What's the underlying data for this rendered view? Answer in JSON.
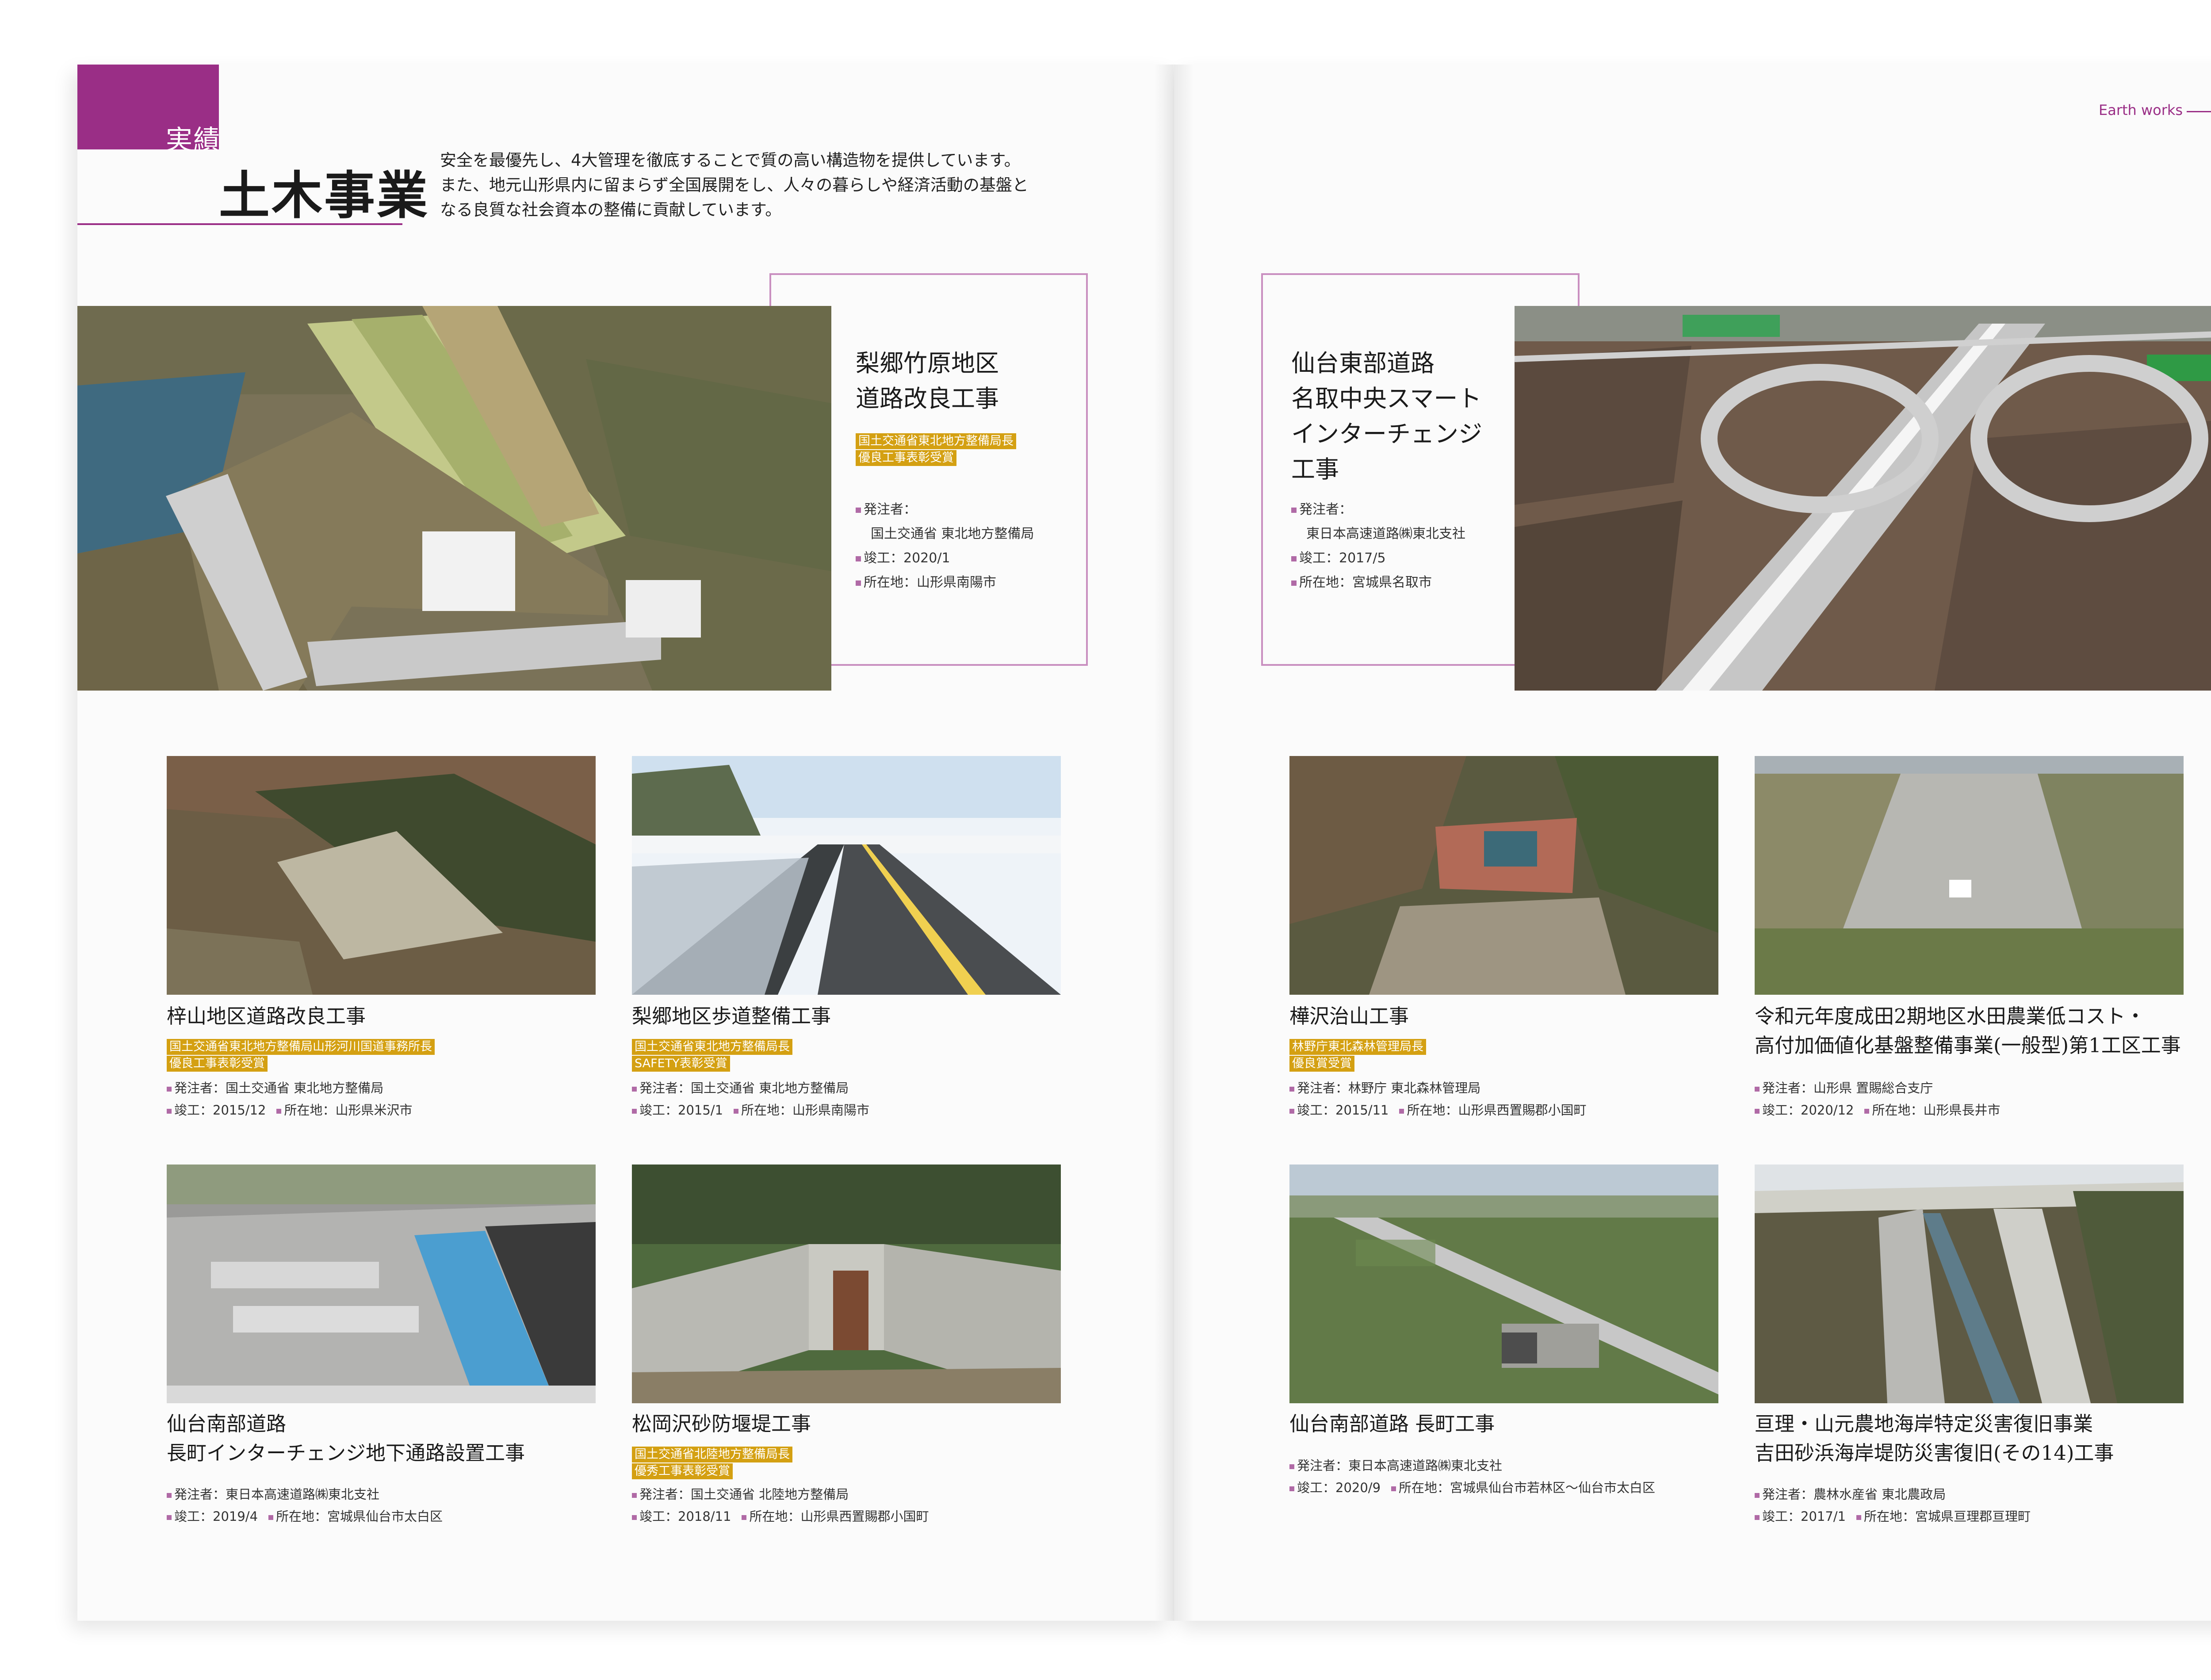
{
  "left_page": {
    "section_tag": "実績",
    "section_title": "土木事業",
    "intro_lines": [
      "安全を最優先し、4大管理を徹底することで質の高い構造物を提供しています。",
      "また、地元山形県内に留まらず全国展開をし、人々の暮らしや経済活動の基盤と",
      "なる良質な社会資本の整備に貢献しています。"
    ]
  },
  "right_page": {
    "brand": "Earth works"
  },
  "labels": {
    "orderer": "発注者：",
    "completed": "竣工：",
    "location": "所在地："
  },
  "features": [
    {
      "title_lines": [
        "梨郷竹原地区",
        "道路改良工事"
      ],
      "awards": [
        "国土交通省東北地方整備局長",
        "優良工事表彰受賞"
      ],
      "orderer_label": "発注者：",
      "orderer": "国土交通省 東北地方整備局",
      "completed_label": "竣工：",
      "completed": "2020/1",
      "location_label": "所在地：",
      "location": "山形県南陽市"
    },
    {
      "title_lines": [
        "仙台東部道路",
        "名取中央スマート",
        "インターチェンジ",
        "工事"
      ],
      "orderer_label": "発注者：",
      "orderer": "東日本高速道路㈱東北支社",
      "completed_label": "竣工：",
      "completed": "2017/5",
      "location_label": "所在地：",
      "location": "宮城県名取市"
    }
  ],
  "projects": [
    {
      "title_lines": [
        "梓山地区道路改良工事"
      ],
      "awards": [
        "国土交通省東北地方整備局山形河川国道事務所長",
        "優良工事表彰受賞"
      ],
      "orderer": "発注者：国土交通省 東北地方整備局",
      "completed": "竣工：2015/12",
      "location": "所在地：山形県米沢市"
    },
    {
      "title_lines": [
        "梨郷地区歩道整備工事"
      ],
      "awards": [
        "国土交通省東北地方整備局長",
        "SAFETY表彰受賞"
      ],
      "orderer": "発注者：国土交通省 東北地方整備局",
      "completed": "竣工：2015/1",
      "location": "所在地：山形県南陽市"
    },
    {
      "title_lines": [
        "仙台南部道路",
        "長町インターチェンジ地下通路設置工事"
      ],
      "awards": [],
      "orderer": "発注者：東日本高速道路㈱東北支社",
      "completed": "竣工：2019/4",
      "location": "所在地：宮城県仙台市太白区"
    },
    {
      "title_lines": [
        "松岡沢砂防堰堤工事"
      ],
      "awards": [
        "国土交通省北陸地方整備局長",
        "優秀工事表彰受賞"
      ],
      "orderer": "発注者：国土交通省 北陸地方整備局",
      "completed": "竣工：2018/11",
      "location": "所在地：山形県西置賜郡小国町"
    },
    {
      "title_lines": [
        "樺沢治山工事"
      ],
      "awards": [
        "林野庁東北森林管理局長",
        "優良賞受賞"
      ],
      "orderer": "発注者：林野庁 東北森林管理局",
      "completed": "竣工：2015/11",
      "location": "所在地：山形県西置賜郡小国町"
    },
    {
      "title_lines": [
        "令和元年度成田2期地区水田農業低コスト・",
        "高付加価値化基盤整備事業(一般型)第1工区工事"
      ],
      "awards": [],
      "orderer": "発注者：山形県 置賜総合支庁",
      "completed": "竣工：2020/12",
      "location": "所在地：山形県長井市"
    },
    {
      "title_lines": [
        "仙台南部道路 長町工事"
      ],
      "awards": [],
      "orderer": "発注者：東日本高速道路㈱東北支社",
      "completed": "竣工：2020/9",
      "location": "所在地：宮城県仙台市若林区～仙台市太白区"
    },
    {
      "title_lines": [
        "亘理・山元農地海岸特定災害復旧事業",
        "吉田砂浜海岸堤防災害復旧(その14)工事"
      ],
      "awards": [],
      "orderer": "発注者：農林水産省 東北農政局",
      "completed": "竣工：2017/1",
      "location": "所在地：宮城県亘理郡亘理町"
    }
  ]
}
